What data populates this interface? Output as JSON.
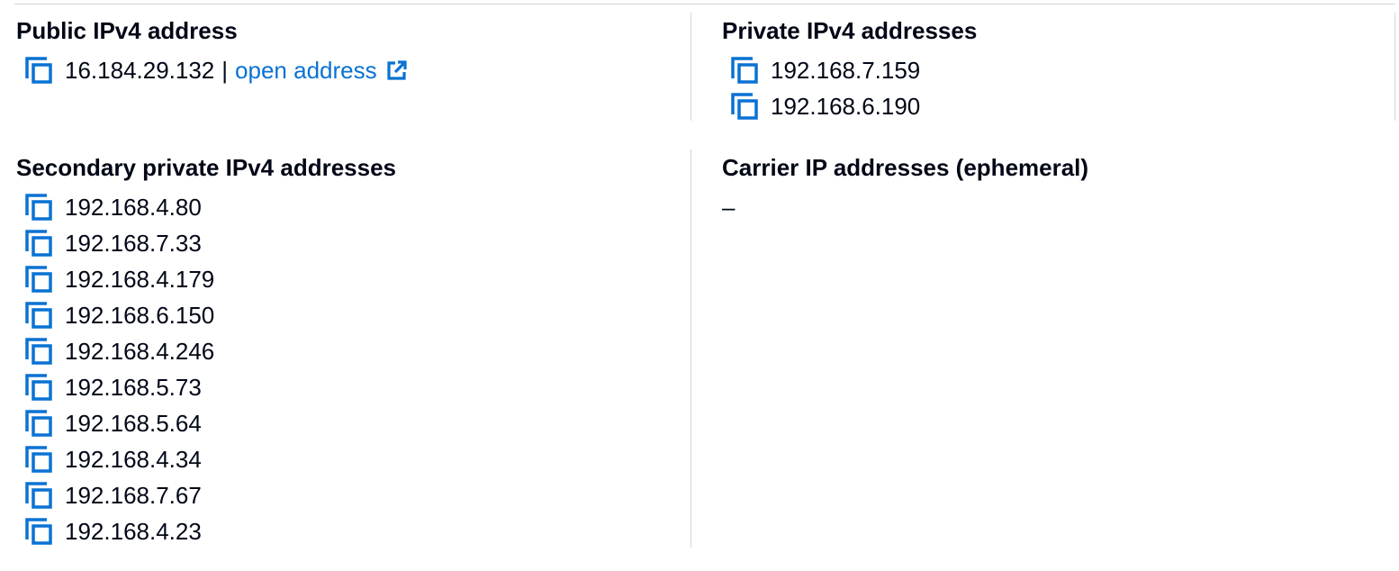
{
  "public_ipv4": {
    "label": "Public IPv4 address",
    "value": "16.184.29.132",
    "separator": "|",
    "link_text": "open address",
    "link_icon": "external-link-icon"
  },
  "private_ipv4": {
    "label": "Private IPv4 addresses",
    "addresses": [
      "192.168.7.159",
      "192.168.6.190"
    ]
  },
  "secondary_private_ipv4": {
    "label": "Secondary private IPv4 addresses",
    "addresses": [
      "192.168.4.80",
      "192.168.7.33",
      "192.168.4.179",
      "192.168.6.150",
      "192.168.4.246",
      "192.168.5.73",
      "192.168.5.64",
      "192.168.4.34",
      "192.168.7.67",
      "192.168.4.23"
    ]
  },
  "carrier_ip": {
    "label": "Carrier IP addresses (ephemeral)",
    "value": "–"
  },
  "icons": {
    "copy": "copy-icon",
    "external": "external-link-icon"
  },
  "colors": {
    "link": "#0972d3",
    "text": "#000716",
    "divider": "#d1d5db"
  }
}
